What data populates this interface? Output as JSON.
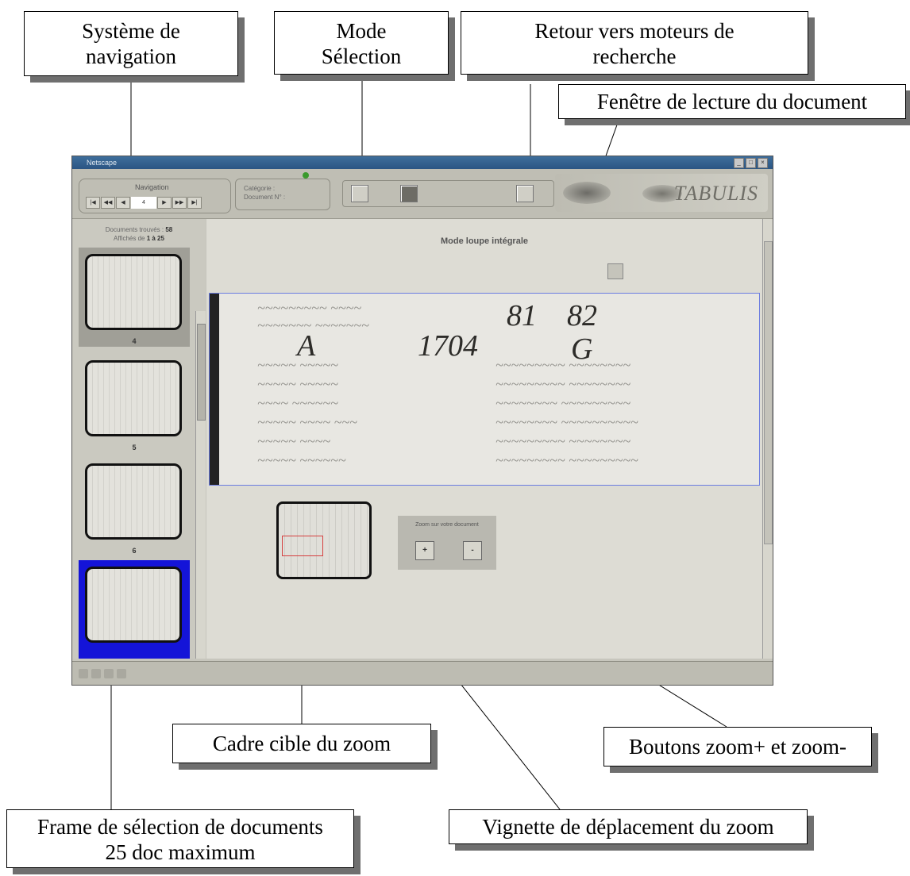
{
  "callouts": {
    "navigation": [
      "Système de",
      "navigation"
    ],
    "selection_mode": [
      "Mode",
      "Sélection"
    ],
    "search_return": [
      "Retour vers moteurs de",
      "recherche"
    ],
    "reading_window": "Fenêtre de lecture du document",
    "zoom_target_frame": "Cadre cible du zoom",
    "zoom_buttons": "Boutons zoom+ et zoom-",
    "selection_frame": [
      "Frame de sélection de documents",
      "25 doc maximum"
    ],
    "zoom_thumbnail": "Vignette de déplacement du zoom"
  },
  "browser": {
    "title": "Netscape",
    "navigation_label": "Navigation",
    "category_label": "Catégorie :",
    "document_label": "Document N° :",
    "logo": "TABULIS"
  },
  "sidebar": {
    "found_label": "Documents trouvés :",
    "found_count": "58",
    "shown_label": "Affichés de",
    "shown_range": "1 à 25",
    "thumbnails": [
      "4",
      "5",
      "6",
      ""
    ]
  },
  "content": {
    "title": "Mode loupe intégrale",
    "zoom_label": "Zoom sur votre document",
    "zoom_in": "+",
    "zoom_out": "-",
    "handwriting_big": [
      "1704",
      "A",
      "81",
      "82",
      "G"
    ]
  },
  "colors": {
    "selected_thumb_bg": "#1414d8",
    "callout_shadow": "#6f6f6f",
    "zoom_frame": "#d54040"
  }
}
